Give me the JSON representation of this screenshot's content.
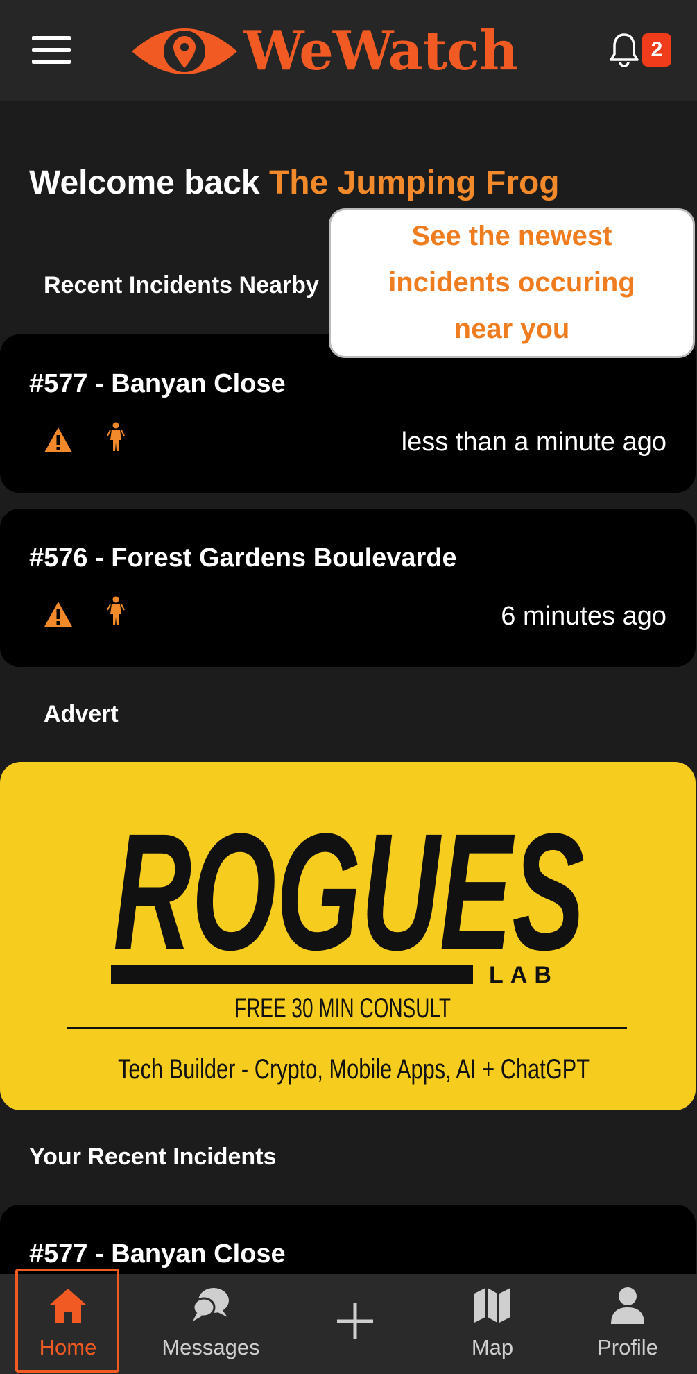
{
  "header": {
    "app_name": "WeWatch",
    "notification_count": "2",
    "menu_icon": "hamburger-menu-icon",
    "bell_icon": "bell-icon",
    "brand_color": "#f15a22"
  },
  "welcome": {
    "prefix": "Welcome back",
    "user_name": "The Jumping Frog"
  },
  "nearby": {
    "title": "Recent Incidents Nearby",
    "incidents": [
      {
        "title": "#577 - Banyan Close",
        "time": "less than a minute ago"
      },
      {
        "title": "#576 - Forest Gardens Boulevarde",
        "time": "6 minutes ago"
      }
    ]
  },
  "tooltip": {
    "lines": [
      "See the newest",
      "incidents occuring",
      "near you"
    ]
  },
  "advert": {
    "label": "Advert",
    "brand": "ROGUES",
    "sub_brand": "LAB",
    "offer": "FREE 30 MIN CONSULT",
    "tagline": "Tech Builder - Crypto, Mobile Apps, AI + ChatGPT"
  },
  "your_recent": {
    "title": "Your Recent Incidents",
    "incidents": [
      {
        "title": "#577 - Banyan Close"
      }
    ]
  },
  "nav": {
    "items": [
      {
        "label": "Home",
        "icon": "home-icon",
        "active": true
      },
      {
        "label": "Messages",
        "icon": "chat-bubbles-icon"
      },
      {
        "label": "",
        "icon": "plus-icon"
      },
      {
        "label": "Map",
        "icon": "map-icon"
      },
      {
        "label": "Profile",
        "icon": "person-icon"
      }
    ]
  }
}
